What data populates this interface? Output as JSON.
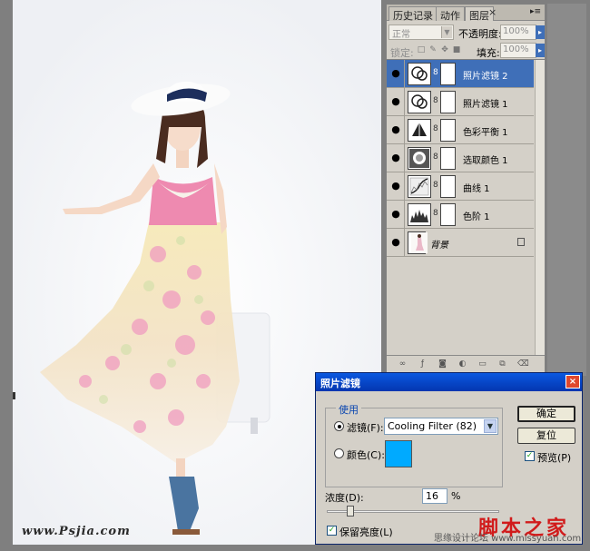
{
  "canvas": {
    "watermark": "www.Psjia.com"
  },
  "layers_panel": {
    "tabs": [
      {
        "label": "历史记录"
      },
      {
        "label": "动作"
      },
      {
        "label": "图层"
      }
    ],
    "tab_close": "×",
    "menu_icon": "▸≡",
    "blend_mode": "正常",
    "opacity_label": "不透明度:",
    "opacity_value": "100%",
    "lock_label": "锁定:",
    "fill_label": "填充:",
    "fill_value": "100%",
    "layers": [
      {
        "name": "照片滤镜 2",
        "icon": "photo-filter-thumb",
        "selected": true
      },
      {
        "name": "照片滤镜 1",
        "icon": "photo-filter-thumb",
        "selected": false
      },
      {
        "name": "色彩平衡 1",
        "icon": "color-balance-thumb",
        "selected": false
      },
      {
        "name": "选取颜色 1",
        "icon": "selective-color-thumb",
        "selected": false
      },
      {
        "name": "曲线 1",
        "icon": "curves-thumb",
        "selected": false
      },
      {
        "name": "色阶 1",
        "icon": "levels-thumb",
        "selected": false
      },
      {
        "name": "背景",
        "icon": "background-photo-thumb",
        "selected": false
      }
    ]
  },
  "dialog": {
    "title": "照片滤镜",
    "close": "×",
    "group_title": "使用",
    "filter_radio_label": "滤镜(F):",
    "filter_value": "Cooling Filter (82)",
    "color_radio_label": "颜色(C):",
    "color_swatch": "#00aaff",
    "density_label": "浓度(D):",
    "density_value": "16",
    "density_unit": "%",
    "preserve_label": "保留亮度(L)",
    "ok_label": "确定",
    "reset_label": "复位",
    "preview_label": "预览(P)",
    "footer_watermark": "思缘设计论坛 www.missyuan.com",
    "site_mark": "脚本之家"
  },
  "colors": {
    "selected_layer": "#3f6fb8",
    "titlebar": "#0a58e0",
    "swatch": "#00aaff"
  }
}
